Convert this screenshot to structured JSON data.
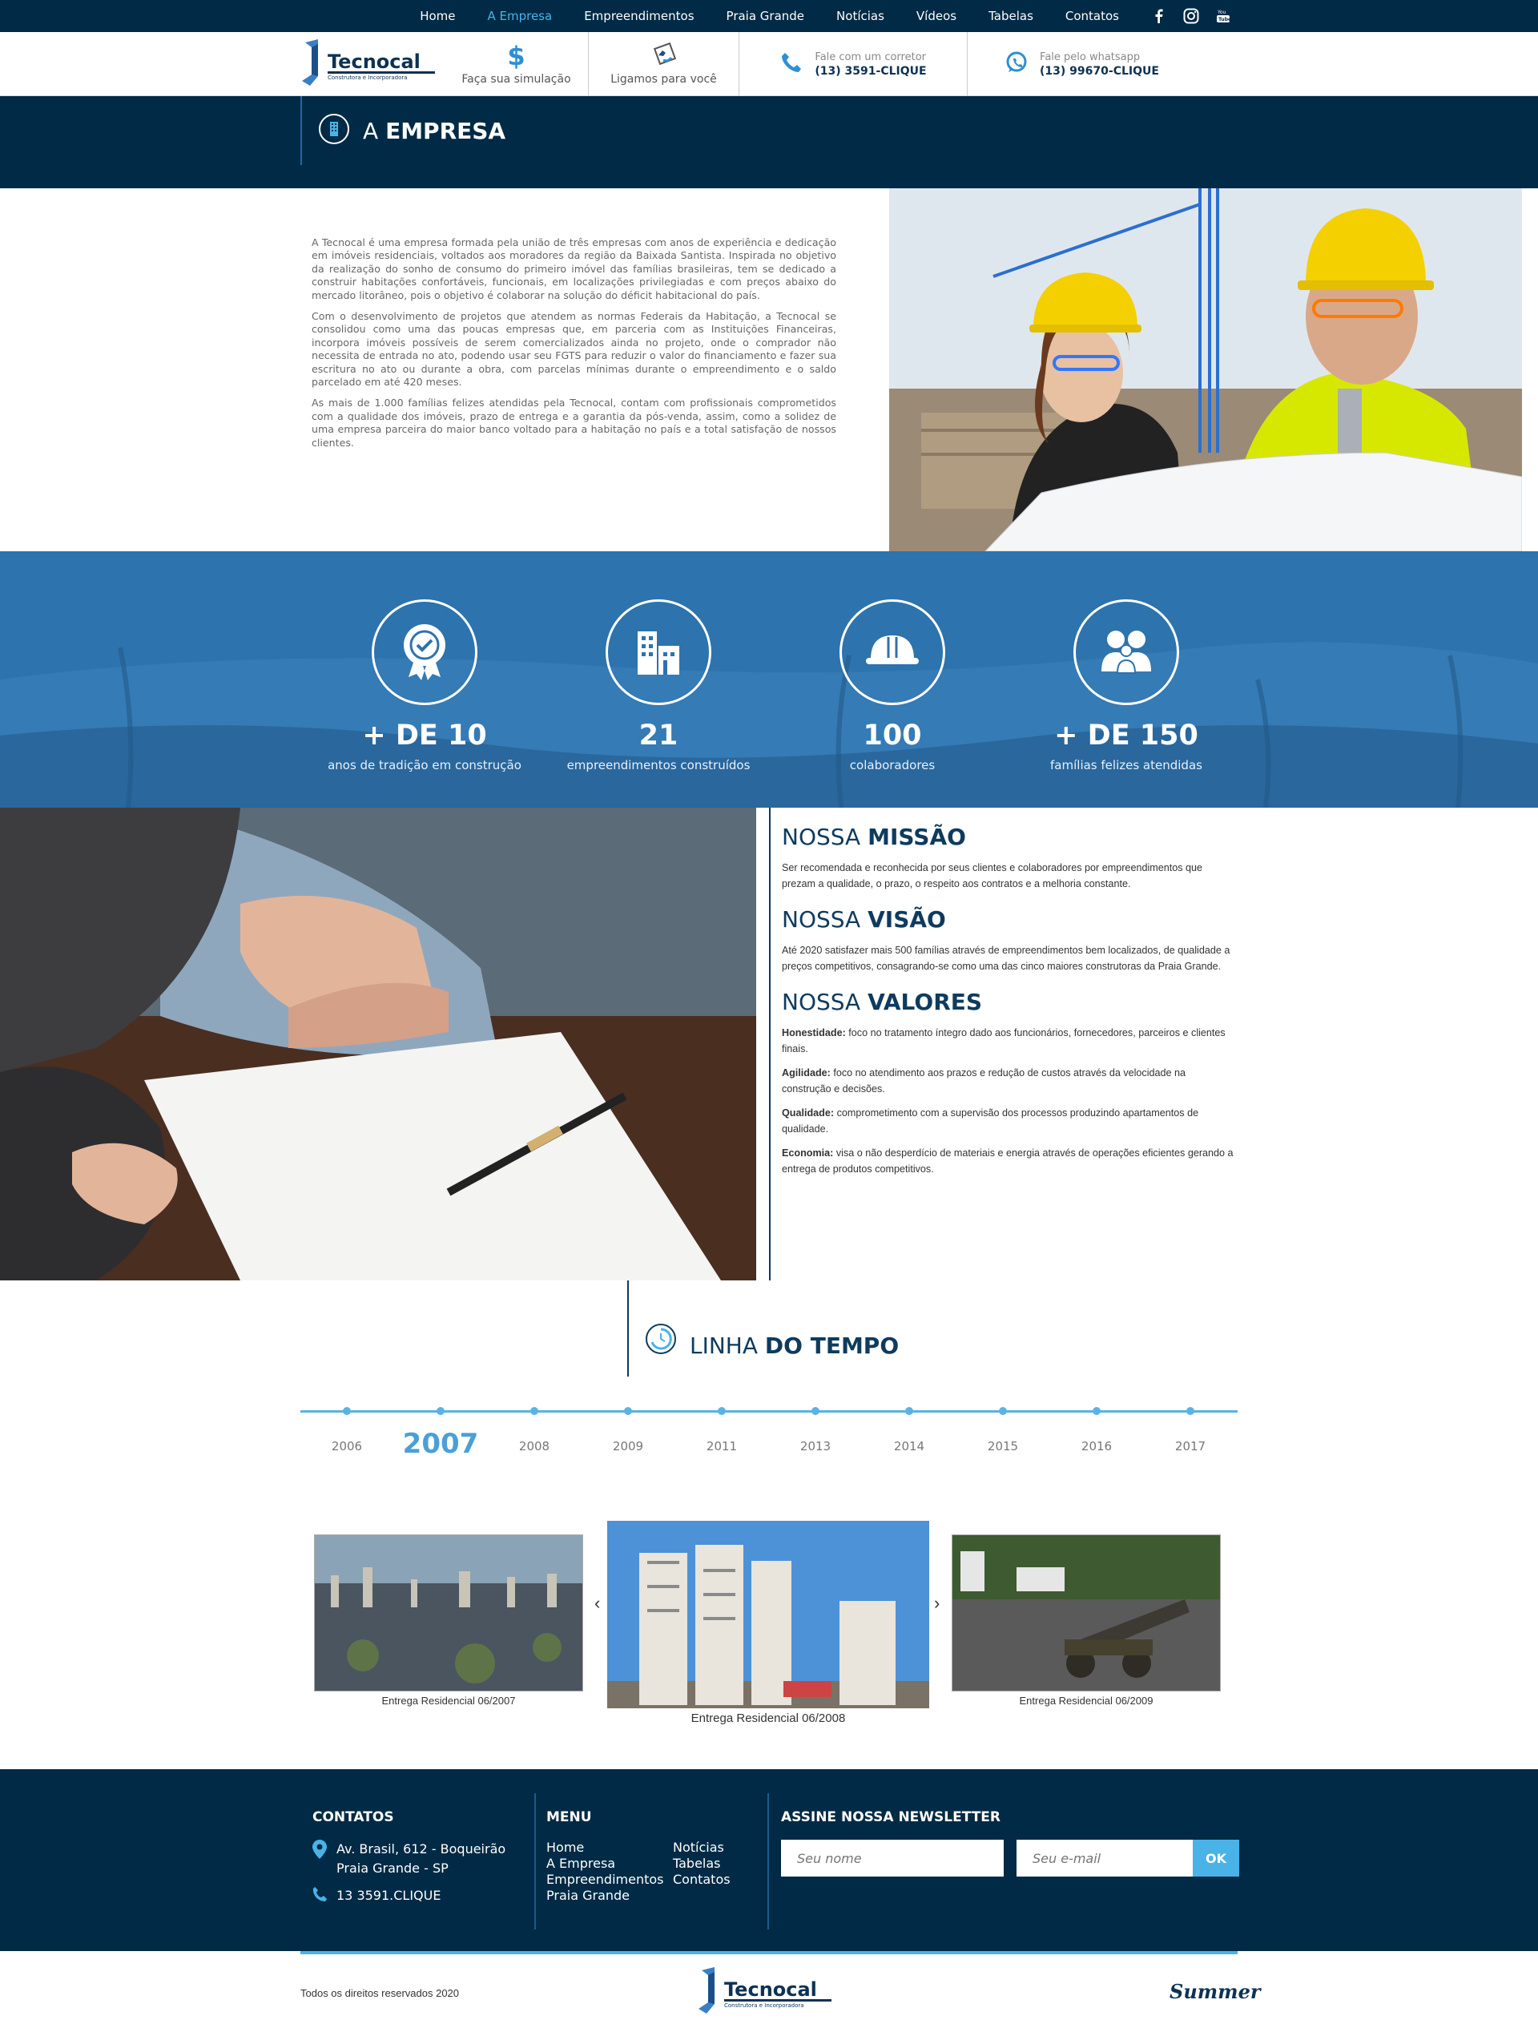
{
  "nav": {
    "items": [
      "Home",
      "A Empresa",
      "Empreendimentos",
      "Praia Grande",
      "Notícias",
      "Vídeos",
      "Tabelas",
      "Contatos"
    ],
    "active": "A Empresa"
  },
  "social": {
    "icons": [
      "facebook-icon",
      "instagram-icon",
      "youtube-icon"
    ]
  },
  "header": {
    "logo_text": "Tecnocal",
    "logo_sub": "Construtora e Incorporadora",
    "simulate": "Faça sua simulação",
    "callback": "Ligamos para você",
    "broker_label": "Fale com um corretor",
    "broker_phone": "(13) 3591-CLIQUE",
    "whatsapp_label": "Fale pelo whatsapp",
    "whatsapp_phone": "(13) 99670-CLIQUE"
  },
  "page_title": {
    "light": "A ",
    "bold": "EMPRESA"
  },
  "about": {
    "p1": "A Tecnocal é uma empresa formada pela união de três empresas com anos de experiência e dedicação em imóveis residenciais, voltados aos moradores da região da Baixada Santista. Inspirada no objetivo da realização do sonho de consumo do primeiro imóvel das famílias brasileiras, tem se dedicado a construir habitações confortáveis, funcionais, em localizações privilegiadas e com preços abaixo do mercado litorâneo, pois o objetivo é colaborar na solução do déficit habitacional do país.",
    "p2": "Com o desenvolvimento de projetos que atendem as normas Federais da Habitação, a Tecnocal se consolidou como uma das poucas empresas que, em parceria com as Instituições Financeiras, incorpora imóveis possíveis de serem comercializados ainda no projeto, onde o comprador não necessita de entrada no ato, podendo usar seu FGTS para reduzir o valor do financiamento e fazer sua escritura no ato ou durante a obra, com parcelas mínimas durante o empreendimento e o saldo parcelado em até 420 meses.",
    "p3": "As mais de 1.000 famílias felizes atendidas pela Tecnocal, contam com profissionais comprometidos com a qualidade dos imóveis, prazo de entrega e a garantia da pós-venda, assim, como a solidez de uma empresa parceira do maior banco voltado para a habitação no país e a total satisfação de nossos clientes."
  },
  "stats": [
    {
      "num": "+ DE 10",
      "label": "anos de tradição em construção",
      "icon": "award-icon"
    },
    {
      "num": "21",
      "label": "empreendimentos construídos",
      "icon": "buildings-icon"
    },
    {
      "num": "100",
      "label": "colaboradores",
      "icon": "hardhat-icon"
    },
    {
      "num": "+ DE 150",
      "label": "famílias felizes atendidas",
      "icon": "family-icon"
    }
  ],
  "mission": {
    "h_light": "NOSSA ",
    "h_bold": "MISSÃO",
    "text": "Ser recomendada e reconhecida por seus clientes e colaboradores por empreendimentos que prezam a qualidade, o prazo, o respeito aos contratos e a melhoria constante."
  },
  "vision": {
    "h_light": "NOSSA ",
    "h_bold": "VISÃO",
    "text": "Até 2020 satisfazer mais 500 famílias através de empreendimentos bem localizados, de qualidade a preços competitivos, consagrando-se como uma das cinco maiores construtoras da Praia Grande."
  },
  "values": {
    "h_light": "NOSSA ",
    "h_bold": "VALORES",
    "items": [
      {
        "k": "Honestidade:",
        "v": " foco no tratamento íntegro dado aos funcionários, fornecedores, parceiros e clientes finais."
      },
      {
        "k": "Agilidade:",
        "v": " foco no atendimento aos prazos e redução de custos através da velocidade na construção e decisões."
      },
      {
        "k": "Qualidade:",
        "v": " comprometimento com a supervisão dos processos produzindo apartamentos de qualidade."
      },
      {
        "k": "Economia:",
        "v": " visa o não desperdício de materiais e energia através de operações eficientes gerando a entrega de produtos competitivos."
      }
    ]
  },
  "timeline": {
    "h_light": "LINHA ",
    "h_bold": "DO TEMPO",
    "years": [
      "2006",
      "2007",
      "2008",
      "2009",
      "2011",
      "2013",
      "2014",
      "2015",
      "2016",
      "2017"
    ],
    "selected": "2007",
    "slides": [
      "Entrega Residencial 06/2007",
      "Entrega Residencial 06/2008",
      "Entrega Residencial 06/2009"
    ],
    "prev": "‹",
    "next": "›"
  },
  "footer": {
    "contacts_title": "CONTATOS",
    "address1": "Av. Brasil, 612 - Boqueirão",
    "address2": "Praia Grande - SP",
    "phone": "13 3591.CLIQUE",
    "menu_title": "MENU",
    "menu": [
      "Home",
      "Notícias",
      "A Empresa",
      "Tabelas",
      "Empreendimentos",
      "Contatos",
      "Praia Grande"
    ],
    "newsletter_title": "ASSINE NOSSA NEWSLETTER",
    "name_ph": "Seu nome",
    "email_ph": "Seu e-mail",
    "ok": "OK"
  },
  "bottom": {
    "copyright": "Todos os direitos reservados 2020",
    "logo_text": "Tecnocal",
    "agency": "Summer"
  },
  "colors": {
    "navy": "#002a45",
    "blue": "#2d73ad",
    "accent": "#49b3e8"
  }
}
